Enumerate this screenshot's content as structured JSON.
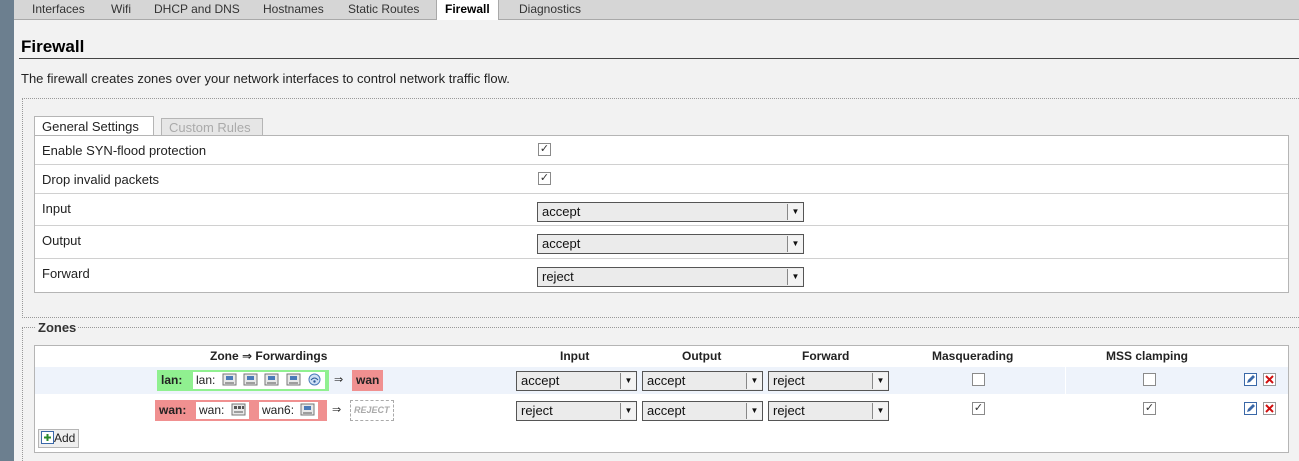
{
  "tabs": [
    {
      "label": "Interfaces",
      "active": false
    },
    {
      "label": "Wifi",
      "active": false
    },
    {
      "label": "DHCP and DNS",
      "active": false
    },
    {
      "label": "Hostnames",
      "active": false
    },
    {
      "label": "Static Routes",
      "active": false
    },
    {
      "label": "Firewall",
      "active": true
    },
    {
      "label": "Diagnostics",
      "active": false
    }
  ],
  "page": {
    "title": "Firewall",
    "description": "The firewall creates zones over your network interfaces to control network traffic flow."
  },
  "subtabs": [
    {
      "label": "General Settings",
      "active": true
    },
    {
      "label": "Custom Rules",
      "active": false
    }
  ],
  "settings": {
    "syn_flood": {
      "label": "Enable SYN-flood protection",
      "checked": true
    },
    "drop_invalid": {
      "label": "Drop invalid packets",
      "checked": true
    },
    "input": {
      "label": "Input",
      "value": "accept"
    },
    "output": {
      "label": "Output",
      "value": "accept"
    },
    "forward": {
      "label": "Forward",
      "value": "reject"
    }
  },
  "zones": {
    "legend": "Zones",
    "headers": {
      "zone_forwardings": "Zone ⇒ Forwardings",
      "input": "Input",
      "output": "Output",
      "forward": "Forward",
      "masquerading": "Masquerading",
      "mss_clamping": "MSS clamping"
    },
    "rows": [
      {
        "zone": "lan:",
        "networks": [
          {
            "name": "lan:",
            "icons": [
              "ethernet-icon",
              "ethernet-icon",
              "ethernet-icon",
              "ethernet-icon",
              "wifi-icon"
            ]
          }
        ],
        "arrow": "⇒",
        "forward_target": "wan",
        "input": "accept",
        "output": "accept",
        "forward": "reject",
        "masquerading": false,
        "mss_clamping": false
      },
      {
        "zone": "wan:",
        "networks": [
          {
            "name": "wan:",
            "icons": [
              "ethernet-switch-icon"
            ]
          },
          {
            "name": "wan6:",
            "icons": [
              "ethernet-icon"
            ]
          }
        ],
        "arrow": "⇒",
        "forward_target": "REJECT",
        "input": "reject",
        "output": "accept",
        "forward": "reject",
        "masquerading": true,
        "mss_clamping": true
      }
    ],
    "add_label": "Add"
  },
  "colors": {
    "zone_lan": "#90f090",
    "zone_wan": "#f09090",
    "sidebar": "#6c7f8f"
  }
}
